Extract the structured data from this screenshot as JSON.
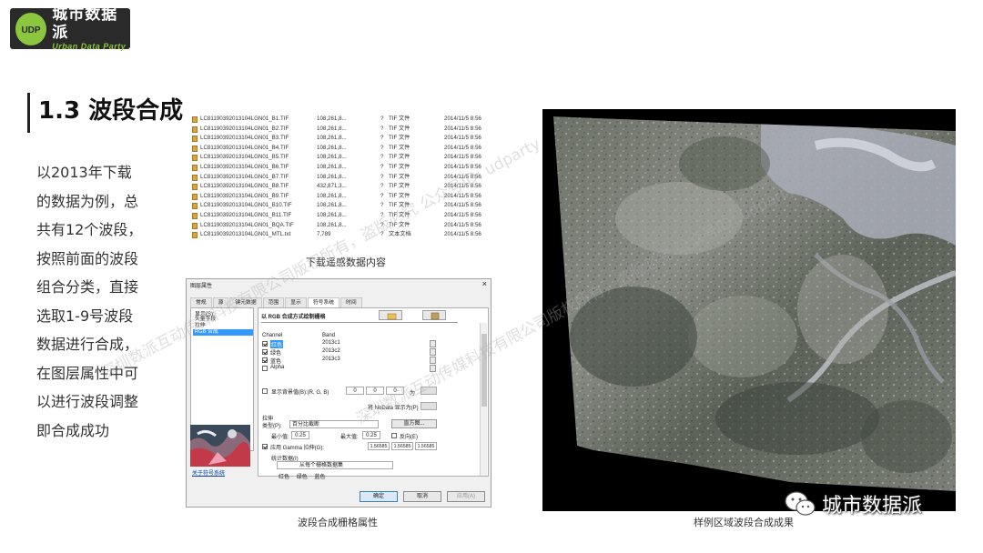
{
  "logo": {
    "cn": "城市数据派",
    "en": "Urban Data Party"
  },
  "heading": "1.3 波段合成",
  "body_lines": [
    "以2013年下载",
    "的数据为例，总",
    "共有12个波段，",
    "按照前面的波段",
    "组合分类，直接",
    "选取1-9号波段",
    "数据进行合成，",
    "在图层属性中可",
    "以进行波段调整",
    "即合成成功"
  ],
  "files": [
    {
      "name": "LC81190392013104LGN01_B1.TIF",
      "size": "108,261,8...",
      "q": "?",
      "type": "TIF 文件",
      "date": "2014/11/5 8:56"
    },
    {
      "name": "LC81190392013104LGN01_B2.TIF",
      "size": "108,261,8...",
      "q": "?",
      "type": "TIF 文件",
      "date": "2014/11/5 8:56"
    },
    {
      "name": "LC81190392013104LGN01_B3.TIF",
      "size": "108,261,8...",
      "q": "?",
      "type": "TIF 文件",
      "date": "2014/11/5 8:56"
    },
    {
      "name": "LC81190392013104LGN01_B4.TIF",
      "size": "108,261,8...",
      "q": "?",
      "type": "TIF 文件",
      "date": "2014/11/5 8:56"
    },
    {
      "name": "LC81190392013104LGN01_B5.TIF",
      "size": "108,261,8...",
      "q": "?",
      "type": "TIF 文件",
      "date": "2014/11/5 8:56"
    },
    {
      "name": "LC81190392013104LGN01_B6.TIF",
      "size": "108,261,8...",
      "q": "?",
      "type": "TIF 文件",
      "date": "2014/11/5 8:56"
    },
    {
      "name": "LC81190392013104LGN01_B7.TIF",
      "size": "108,261,8...",
      "q": "?",
      "type": "TIF 文件",
      "date": "2014/11/5 8:56"
    },
    {
      "name": "LC81190392013104LGN01_B8.TIF",
      "size": "432,871,3...",
      "q": "?",
      "type": "TIF 文件",
      "date": "2014/11/5 8:56"
    },
    {
      "name": "LC81190392013104LGN01_B9.TIF",
      "size": "108,261,8...",
      "q": "?",
      "type": "TIF 文件",
      "date": "2014/11/5 8:56"
    },
    {
      "name": "LC81190392013104LGN01_B10.TIF",
      "size": "108,261,8...",
      "q": "?",
      "type": "TIF 文件",
      "date": "2014/11/5 8:56"
    },
    {
      "name": "LC81190392013104LGN01_B11.TIF",
      "size": "108,261,8...",
      "q": "?",
      "type": "TIF 文件",
      "date": "2014/11/5 8:56"
    },
    {
      "name": "LC81190392013104LGN01_BQA.TIF",
      "size": "108,261,8...",
      "q": "?",
      "type": "TIF 文件",
      "date": "2014/11/5 8:56"
    },
    {
      "name": "LC81190392013104LGN01_MTL.txt",
      "size": "7,789",
      "q": "?",
      "type": "文本文档",
      "date": "2014/11/5 8:56"
    }
  ],
  "captions": {
    "files": "下载遥感数据内容",
    "dialog": "波段合成栅格属性",
    "image": "样例区域波段合成成果"
  },
  "dialog": {
    "title": "图层属性",
    "close": "×",
    "tabs": [
      "常规",
      "源",
      "键元数据",
      "范围",
      "显示",
      "符号系统",
      "时间"
    ],
    "active_tab": 5,
    "left_label": "显示(S):",
    "left_items": [
      "矢量字段",
      "拉伸",
      "RGB 合成"
    ],
    "left_link": "关于符号系统",
    "panel_title": "以 RGB 合成方式绘制栅格",
    "channel_header": "Channel",
    "band_header": "Band",
    "channels": [
      {
        "name": "红色",
        "band": "2013c1",
        "checked": true
      },
      {
        "name": "绿色",
        "band": "2013c2",
        "checked": true
      },
      {
        "name": "蓝色",
        "band": "2013c3",
        "checked": true
      },
      {
        "name": "Alpha",
        "band": "",
        "checked": false
      }
    ],
    "bg_label": "显示背景值(B):(R, G, B)",
    "bg_values": [
      "0",
      "0",
      "0"
    ],
    "as_label": "为",
    "nodata_label": "将 NoData 显示为(P)",
    "stretch_label": "拉伸",
    "type_label": "类型(P):",
    "type_value": "百分比截断",
    "hist_btn": "直方图...",
    "min_label": "最小值:",
    "min_value": "0.25",
    "max_label": "最大值:",
    "max_value": "0.25",
    "reverse_label": "反向(E)",
    "gamma_label": "应用 Gamma 拉伸(G):",
    "gamma_values": [
      "1.56585",
      "1.56585",
      "1.56585"
    ],
    "stats_label": "统计数据(I)",
    "stats_value": "从每个栅格数据集",
    "stats_cols": [
      "红色",
      "绿色",
      "蓝色"
    ],
    "ok": "确定",
    "cancel": "取消",
    "apply": "应用(A)"
  },
  "watermark": "深圳数派互动传媒科技有限公司版权所有，盗版必究 公众号ID: udparty",
  "wechat_label": "城市数据派",
  "colors": {
    "logo_green": "#8cc63f",
    "logo_bg": "#2a2a2a",
    "select_blue": "#3399ff"
  }
}
